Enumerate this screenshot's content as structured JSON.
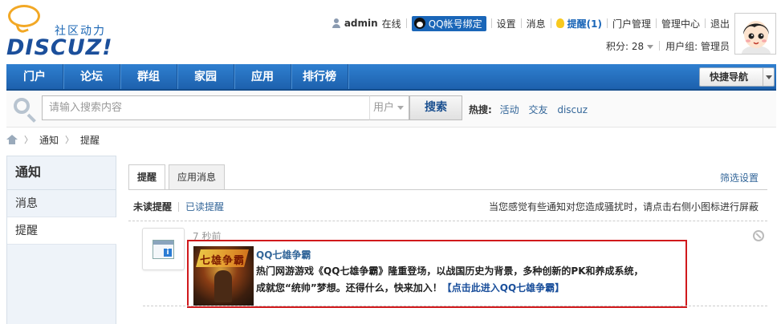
{
  "brand": {
    "cn": "社区动力",
    "en": "DISCUZ!"
  },
  "topbar": {
    "username": "admin",
    "online": "在线",
    "qq_bind": "QQ帐号绑定",
    "settings": "设置",
    "messages": "消息",
    "remind": "提醒(1)",
    "portal_manage": "门户管理",
    "admin_center": "管理中心",
    "logout": "退出",
    "points": "积分: 28",
    "usergroup": "用户组: 管理员"
  },
  "nav": {
    "items": [
      "门户",
      "论坛",
      "群组",
      "家园",
      "应用",
      "排行榜"
    ],
    "quick_nav": "快捷导航"
  },
  "search": {
    "placeholder": "请输入搜索内容",
    "scope": "用户",
    "button": "搜索",
    "hot_label": "热搜:",
    "hot_items": [
      "活动",
      "交友",
      "discuz"
    ]
  },
  "breadcrumb": [
    "通知",
    "提醒"
  ],
  "sidebar": {
    "title": "通知",
    "items": [
      "消息",
      "提醒"
    ]
  },
  "tabs": [
    "提醒",
    "应用消息"
  ],
  "filter_settings": "筛选设置",
  "subtabs": {
    "unread": "未读提醒",
    "read": "已读提醒"
  },
  "hint": "当您感觉有些通知对您造成骚扰时，请点击右侧小图标进行屏蔽",
  "notice": {
    "time": "7 秒前",
    "title": "QQ七雄争霸",
    "desc_line1": "热门网游游戏《QQ七雄争霸》隆重登场，以战国历史为背景，多种创新的PK和养成系统，",
    "desc_line2": "成就您“统帅”梦想。还得什么，快来加入！",
    "link": "【点击此进入QQ七雄争霸】",
    "game_logo_text": "七雄争霸"
  },
  "colors": {
    "nav_bg": "#1d61ad",
    "link": "#336699",
    "highlight": "#d0191c"
  }
}
